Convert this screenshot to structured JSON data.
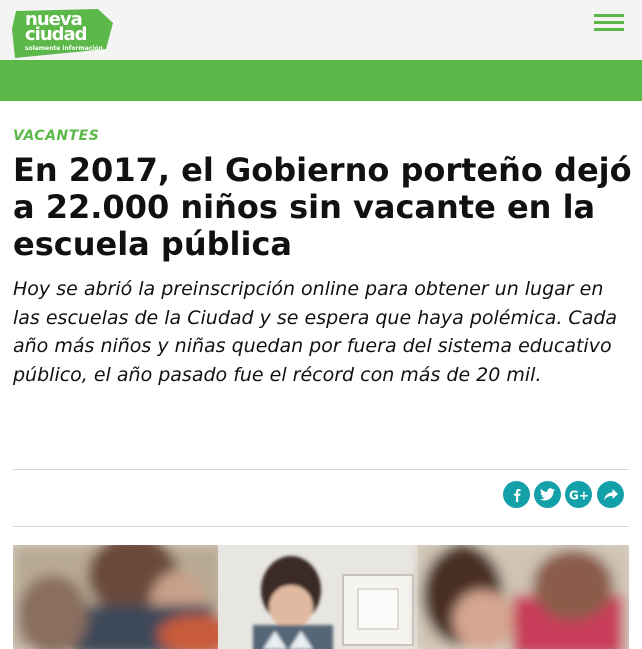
{
  "header": {
    "logo_line1": "nueva",
    "logo_line2": "ciudad",
    "logo_tagline": "solamente información",
    "logo_color": "#5db84a",
    "menu_icon": "hamburger-menu-icon"
  },
  "accent_color": "#5db84a",
  "share_color": "#14a0a8",
  "article": {
    "category": "VACANTES",
    "title": "En 2017, el Gobierno porteño dejó a 22.000 niños sin vacante en la escuela pública",
    "summary": "Hoy se abrió la preinscripción online para obtener un lugar en las escuelas de la Ciudad y se espera que haya polémica. Cada año más niños y niñas quedan por fuera del sistema educativo público, el año pasado fue el récord con más de 20 mil."
  },
  "share_buttons": [
    "facebook-icon",
    "twitter-icon",
    "google-plus-icon",
    "share-icon"
  ]
}
